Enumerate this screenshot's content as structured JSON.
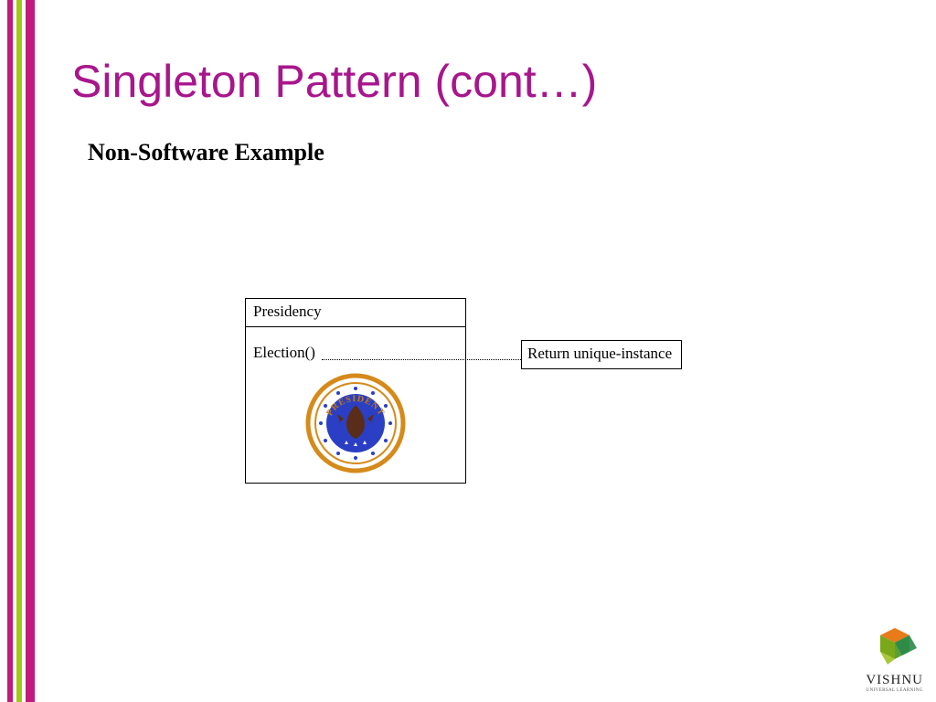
{
  "title": "Singleton Pattern (cont…)",
  "subtitle": "Non-Software Example",
  "diagram": {
    "class_name": "Presidency",
    "method": "Election()",
    "note": "Return unique-instance",
    "seal_text": "PRESIDENT"
  },
  "logo": {
    "name": "VISHNU",
    "tagline": "UNIVERSAL LEARNING"
  }
}
